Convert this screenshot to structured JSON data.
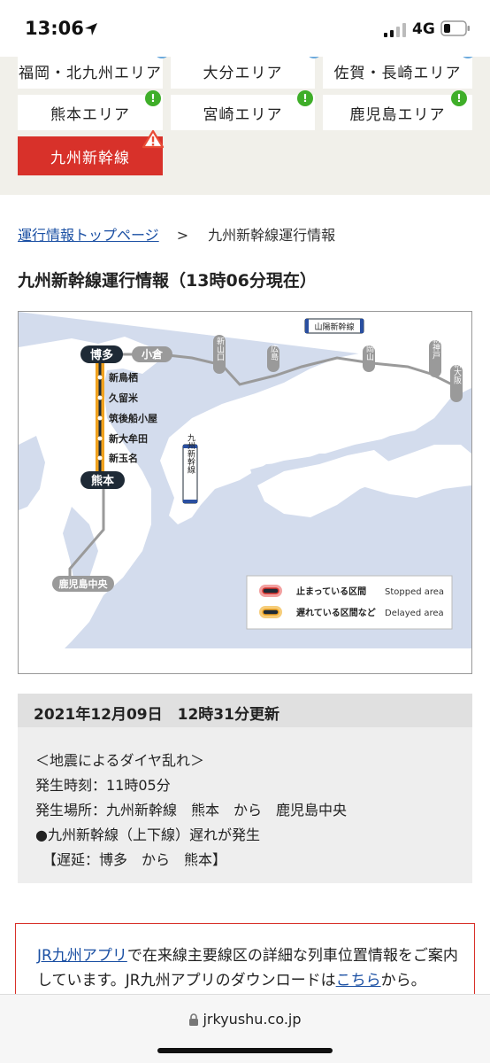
{
  "status_bar": {
    "time": "13:06",
    "network": "4G",
    "icons": [
      "location-arrow-icon",
      "signal-bars-icon",
      "battery-icon"
    ]
  },
  "areas": [
    {
      "label": "福岡・北九州エリア",
      "status": "normal"
    },
    {
      "label": "大分エリア",
      "status": "normal"
    },
    {
      "label": "佐賀・長崎エリア",
      "status": "normal"
    },
    {
      "label": "熊本エリア",
      "status": "info"
    },
    {
      "label": "宮崎エリア",
      "status": "info"
    },
    {
      "label": "鹿児島エリア",
      "status": "info"
    },
    {
      "label": "九州新幹線",
      "status": "warning",
      "active": true
    }
  ],
  "breadcrumb": {
    "top_link": "運行情報トップページ",
    "separator": ">",
    "current": "九州新幹線運行情報"
  },
  "page_title": "九州新幹線運行情報（13時06分現在）",
  "map": {
    "stations_main": [
      "博多",
      "熊本"
    ],
    "stations_between": [
      "新鳥栖",
      "久留米",
      "筑後船小屋",
      "新大牟田",
      "新玉名"
    ],
    "station_kokura": "小倉",
    "station_kagoshima": "鹿児島中央",
    "sanyo_label": "山陽新幹線",
    "sanyo_stations": [
      "新山口",
      "広島",
      "岡山",
      "新神戸",
      "新大阪"
    ],
    "kyushu_label": "九州新幹線",
    "legend": [
      {
        "jp": "止まっている区間",
        "en": "Stopped area",
        "color": "#d8312a"
      },
      {
        "jp": "遅れている区間など",
        "en": "Delayed area",
        "color": "#f0a21f"
      }
    ],
    "colors": {
      "sea": "#d3dced",
      "land": "#ffffff",
      "line": "#9a9a9a",
      "delay": "#f0a21f",
      "station_dark": "#1e2a36"
    }
  },
  "update": {
    "header": "2021年12月09日　12時31分更新",
    "lines": [
      "＜地震によるダイヤ乱れ＞",
      "発生時刻：11時05分",
      "発生場所：九州新幹線　熊本　から　鹿児島中央",
      "●九州新幹線（上下線）遅れが発生",
      "　【遅延：博多　から　熊本】"
    ]
  },
  "banner": {
    "app_link": "JR九州アプリ",
    "text1": "で在来線主要線区の詳細な列車位置情報をご案内しています。JR九州アプリのダウンロードは",
    "here_link": "こちら",
    "text2": "から。"
  },
  "browser": {
    "url": "jrkyushu.co.jp"
  }
}
